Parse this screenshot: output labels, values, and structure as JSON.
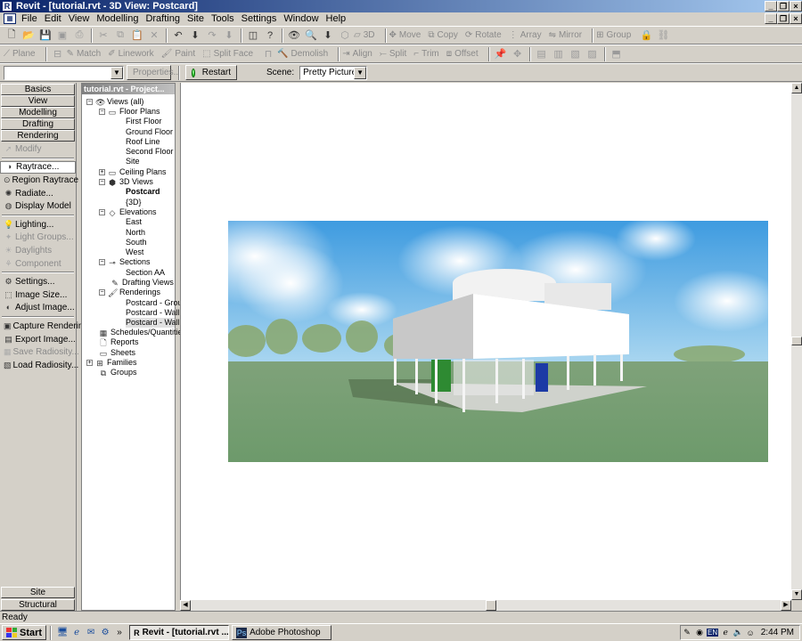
{
  "window": {
    "title": "Revit - [tutorial.rvt - 3D View: Postcard]"
  },
  "menu": [
    "File",
    "Edit",
    "View",
    "Modelling",
    "Drafting",
    "Site",
    "Tools",
    "Settings",
    "Window",
    "Help"
  ],
  "toolbar1": {
    "move": "Move",
    "copy": "Copy",
    "rotate": "Rotate",
    "array": "Array",
    "mirror": "Mirror",
    "group": "Group",
    "view3d": "3D"
  },
  "toolbar2": {
    "plane": "Plane",
    "match": "Match",
    "linework": "Linework",
    "paint": "Paint",
    "split_face": "Split Face",
    "demolish": "Demolish",
    "align": "Align",
    "split": "Split",
    "trim": "Trim",
    "offset": "Offset"
  },
  "toolbar3": {
    "properties": "Properties...",
    "restart": "Restart",
    "scene_label": "Scene:",
    "scene_value": "Pretty Picture"
  },
  "designbar": {
    "tabs_top": [
      "Basics",
      "View",
      "Modelling",
      "Drafting",
      "Rendering"
    ],
    "modify": "Modify",
    "items": {
      "raytrace": "Raytrace...",
      "region_raytrace": "Region Raytrace",
      "radiate": "Radiate...",
      "display_model": "Display Model",
      "lighting": "Lighting...",
      "light_groups": "Light Groups...",
      "daylights": "Daylights",
      "component": "Component",
      "settings": "Settings...",
      "image_size": "Image Size...",
      "adjust_image": "Adjust Image...",
      "capture_rendering": "Capture Rendering",
      "export_image": "Export Image...",
      "save_radiosity": "Save Radiosity...",
      "load_radiosity": "Load Radiosity..."
    },
    "tabs_bottom": [
      "Site",
      "Structural"
    ]
  },
  "browser": {
    "header": "tutorial.rvt - Project...",
    "views_all": "Views (all)",
    "floor_plans": "Floor Plans",
    "floor_plan_items": [
      "First Floor",
      "Ground Floor",
      "Roof Line",
      "Second Floor",
      "Site"
    ],
    "ceiling_plans": "Ceiling Plans",
    "views_3d": "3D Views",
    "views_3d_items": [
      "Postcard",
      "{3D}"
    ],
    "elevations": "Elevations",
    "elevation_items": [
      "East",
      "North",
      "South",
      "West"
    ],
    "sections": "Sections",
    "section_items": [
      "Section AA"
    ],
    "drafting_views": "Drafting Views",
    "renderings": "Renderings",
    "rendering_items": [
      "Postcard - Grou",
      "Postcard - Wall",
      "Postcard - Wall"
    ],
    "schedules": "Schedules/Quantitie",
    "reports": "Reports",
    "sheets": "Sheets",
    "families": "Families",
    "groups": "Groups"
  },
  "status": "Ready",
  "taskbar": {
    "start": "Start",
    "tasks": [
      "Revit - [tutorial.rvt ...",
      "Adobe Photoshop"
    ],
    "lang": "EN",
    "clock": "2:44 PM"
  }
}
